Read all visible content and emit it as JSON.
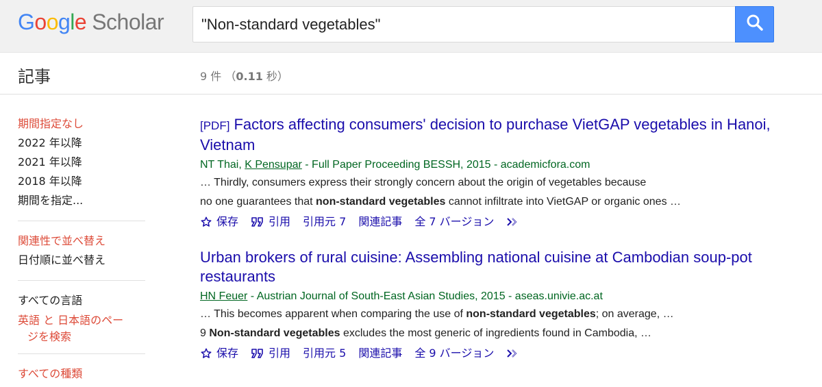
{
  "logo": {
    "google": "Google",
    "scholar": "Scholar"
  },
  "search": {
    "query": "\"Non-standard vegetables\""
  },
  "subheader": {
    "section_title": "記事",
    "count_prefix": "9 件  （",
    "time": "0.11",
    "time_suffix": " 秒）"
  },
  "sidebar": {
    "time_items": [
      "期間指定なし",
      "2022 年以降",
      "2021 年以降",
      "2018 年以降",
      "期間を指定..."
    ],
    "sort_items": [
      "関連性で並べ替え",
      "日付順に並べ替え"
    ],
    "lang_items": [
      "すべての言語"
    ],
    "lang_search_line1": "英語 と 日本語のペー",
    "lang_search_line2": "ジを検索",
    "type_items": [
      "すべての種類"
    ]
  },
  "results": [
    {
      "pdf_tag": "[PDF]",
      "title": "Factors affecting consumers' decision to purchase VietGAP vegetables in Hanoi, Vietnam",
      "author_plain": "NT Thai, ",
      "author_link": "K Pensupar",
      "source": " - Full Paper Proceeding BESSH, 2015 - academicfora.com",
      "snippet_line1": "… Thirdly, consumers express their strongly concern about the origin of vegetables because",
      "snippet_line2_pre": "no one guarantees that ",
      "snippet_line2_bold": "non-standard vegetables",
      "snippet_line2_post": " cannot infiltrate into VietGAP or organic ones …",
      "actions": {
        "save": "保存",
        "cite": "引用",
        "cited_by": "引用元 7",
        "related": "関連記事",
        "versions": "全 7 バージョン"
      }
    },
    {
      "title": "Urban brokers of rural cuisine: Assembling national cuisine at Cambodian soup-pot restaurants",
      "author_link": "HN Feuer",
      "source": " - Austrian Journal of South-East Asian Studies, 2015 - aseas.univie.ac.at",
      "snippet_line1_pre": "… This becomes apparent when comparing the use of ",
      "snippet_line1_bold": "non-standard vegetables",
      "snippet_line1_post": "; on average, …",
      "snippet_line2_pre": "9 ",
      "snippet_line2_bold": "Non-standard vegetables",
      "snippet_line2_post": " excludes the most generic of ingredients found in Cambodia, …",
      "actions": {
        "save": "保存",
        "cite": "引用",
        "cited_by": "引用元 5",
        "related": "関連記事",
        "versions": "全 9 バージョン"
      }
    }
  ],
  "colors": {
    "link": "#1a0dab",
    "meta": "#006621",
    "active": "#dd4b39",
    "search_button": "#4d90fe"
  }
}
